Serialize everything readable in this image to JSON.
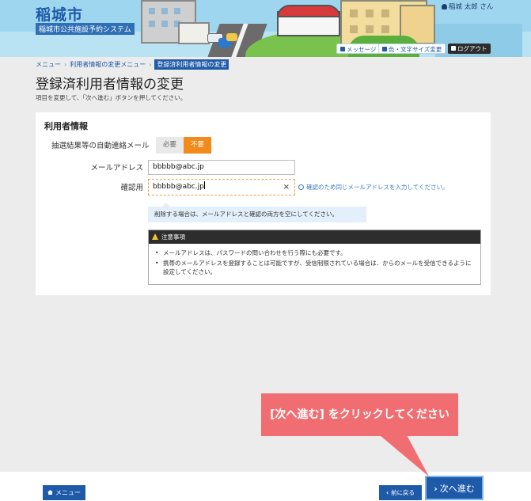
{
  "header": {
    "city_title": "稲城市",
    "system_name": "稲城市公共施設予約システム",
    "user_name": "稲城 太郎 さん",
    "links": {
      "messages": "メッセージ",
      "font_size": "色・文字サイズ変更",
      "logout": "ログアウト"
    }
  },
  "breadcrumb": {
    "items": [
      "メニュー",
      "利用者情報の変更メニュー"
    ],
    "separator": "›",
    "current": "登録済利用者情報の変更"
  },
  "page": {
    "title": "登録済利用者情報の変更",
    "description": "項目を変更して、「次へ進む」ボタンを押してください。"
  },
  "form": {
    "section_title": "利用者情報",
    "mail_setting": {
      "label": "抽選結果等の自動連絡メール",
      "options": [
        "必要",
        "不要"
      ],
      "selected": "不要"
    },
    "email": {
      "label": "メールアドレス",
      "value": "bbbbb@abc.jp"
    },
    "confirm": {
      "label": "確認用",
      "value": "bbbbb@abc.jp",
      "clear_symbol": "×",
      "hint": "確認のため同じメールアドレスを入力してください。"
    },
    "info_message": "削除する場合は、メールアドレスと確認の両方を空にしてください。",
    "notice": {
      "title": "注意事項",
      "items": [
        "メールアドレスは、パスワードの問い合わせを行う際にも必要です。",
        "携帯のメールアドレスを登録することは可能ですが、受信制限されている場合は．からのメールを受信できるように設定してください。"
      ]
    }
  },
  "footer": {
    "menu_button": "メニュー",
    "back_button": "前に戻る",
    "next_button": "次へ進む"
  },
  "callout": {
    "text": "[次へ進む] をクリックしてください"
  },
  "colors": {
    "primary": "#1e5aa8",
    "accent_orange": "#f28a1c",
    "callout": "#f06e72"
  }
}
